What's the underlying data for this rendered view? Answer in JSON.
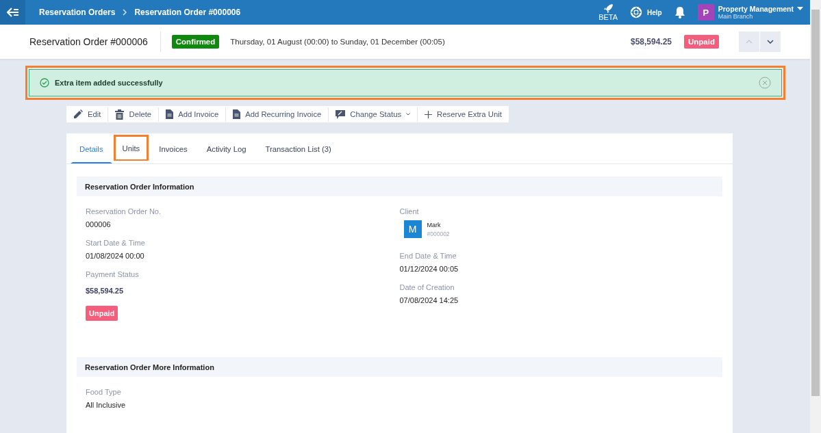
{
  "topbar": {
    "breadcrumbs": [
      "Reservation Orders",
      "Reservation Order #000006"
    ],
    "beta_label": "BETA",
    "help_label": "Help",
    "account": {
      "initial": "P",
      "name": "Property Management",
      "branch": "Main Branch"
    }
  },
  "header": {
    "title": "Reservation Order #000006",
    "status": "Confirmed",
    "period": "Thursday, 01 August (00:00) to Sunday, 01 December (00:05)",
    "amount": "$58,594.25",
    "payment": "Unpaid"
  },
  "alert": {
    "message": "Extra item added successfully",
    "highlighted": true
  },
  "actions": [
    {
      "kind": "edit",
      "label": "Edit"
    },
    {
      "kind": "delete",
      "label": "Delete"
    },
    {
      "kind": "doc",
      "label": "Add Invoice"
    },
    {
      "kind": "doc",
      "label": "Add Recurring Invoice"
    },
    {
      "kind": "status",
      "label": "Change Status",
      "dropdown": true
    },
    {
      "kind": "plus",
      "label": "Reserve Extra Unit"
    }
  ],
  "tabs": [
    {
      "label": "Details",
      "selected": true,
      "highlighted": false
    },
    {
      "label": "Units",
      "selected": false,
      "highlighted": true
    },
    {
      "label": "Invoices",
      "selected": false,
      "highlighted": false
    },
    {
      "label": "Activity Log",
      "selected": false,
      "highlighted": false
    },
    {
      "label": "Transaction List (3)",
      "selected": false,
      "highlighted": false
    }
  ],
  "sections": [
    {
      "title": "Reservation Order Information",
      "left": [
        {
          "kind": "text",
          "label": "Reservation Order No.",
          "value": "000006"
        },
        {
          "kind": "text",
          "label": "Start Date & Time",
          "value": "01/08/2024 00:00"
        },
        {
          "kind": "payment",
          "label": "Payment Status",
          "value": "$58,594.25",
          "badge": "Unpaid"
        }
      ],
      "right": [
        {
          "kind": "client",
          "label": "Client",
          "initial": "M",
          "name": "Mark",
          "code": "#000002"
        },
        {
          "kind": "text",
          "label": "End Date & Time",
          "value": "01/12/2024 00:05"
        },
        {
          "kind": "text",
          "label": "Date of Creation",
          "value": "07/08/2024 14:25"
        }
      ]
    },
    {
      "title": "Reservation Order More Information",
      "left": [
        {
          "kind": "text",
          "label": "Food Type",
          "value": "All Inclusive"
        }
      ]
    }
  ]
}
